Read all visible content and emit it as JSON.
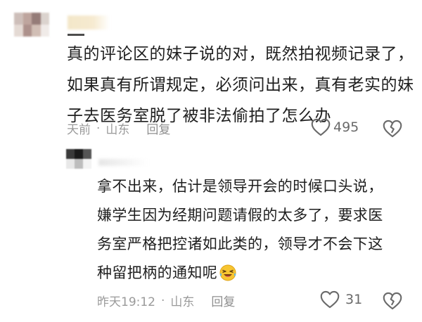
{
  "main_comment": {
    "lines": [
      "真的评论区的妹子说的对，既然拍视频记录了，",
      "如果真有所谓规定，必须问出来，真有老实的妹",
      "子去医务室脱了被非法偷拍了怎么办"
    ],
    "time": "天前",
    "location": "山东",
    "reply_label": "回复",
    "like_count": "495"
  },
  "reply_comment": {
    "lines": [
      "拿不出来，估计是领导开会的时候口头说，",
      "嫌学生因为经期问题请假的太多了，要求医",
      "务室严格把控诸如此类的，领导才不会下这",
      "种留把柄的通知呢"
    ],
    "time": "昨天19:12",
    "location": "山东",
    "reply_label": "回复",
    "like_count": "31"
  },
  "separator": "·",
  "icons": {
    "like": "heart-outline-icon",
    "dislike": "broken-heart-outline-icon",
    "emoji": "laughing-crying-emoji-icon"
  },
  "colors": {
    "text": "#1e1e1e",
    "meta": "#9a9a9a",
    "icon": "#6a6a6a"
  }
}
